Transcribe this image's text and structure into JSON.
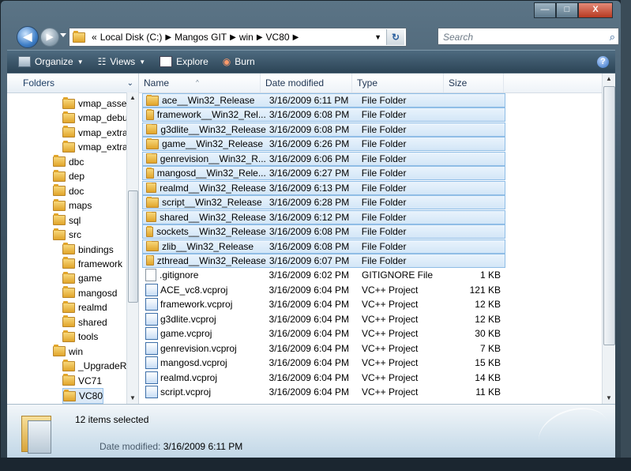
{
  "window": {
    "minimize": "—",
    "maximize": "□",
    "close": "X"
  },
  "address": {
    "chevron": "«",
    "crumbs": [
      "Local Disk (C:)",
      "Mangos GIT",
      "win",
      "VC80"
    ],
    "search_placeholder": "Search"
  },
  "toolbar": {
    "organize": "Organize",
    "views": "Views",
    "explore": "Explore",
    "burn": "Burn"
  },
  "nav": {
    "header": "Folders",
    "items": [
      {
        "label": "vmap_asse",
        "level": 2
      },
      {
        "label": "vmap_debu",
        "level": 2
      },
      {
        "label": "vmap_extra",
        "level": 2
      },
      {
        "label": "vmap_extra",
        "level": 2
      },
      {
        "label": "dbc",
        "level": 1
      },
      {
        "label": "dep",
        "level": 1
      },
      {
        "label": "doc",
        "level": 1
      },
      {
        "label": "maps",
        "level": 1
      },
      {
        "label": "sql",
        "level": 1
      },
      {
        "label": "src",
        "level": 1
      },
      {
        "label": "bindings",
        "level": 2
      },
      {
        "label": "framework",
        "level": 2
      },
      {
        "label": "game",
        "level": 2
      },
      {
        "label": "mangosd",
        "level": 2
      },
      {
        "label": "realmd",
        "level": 2
      },
      {
        "label": "shared",
        "level": 2
      },
      {
        "label": "tools",
        "level": 2
      },
      {
        "label": "win",
        "level": 1
      },
      {
        "label": "_UpgradeR",
        "level": 2
      },
      {
        "label": "VC71",
        "level": 2
      },
      {
        "label": "VC80",
        "level": 2,
        "selected": true
      }
    ]
  },
  "columns": {
    "name": "Name",
    "date": "Date modified",
    "type": "Type",
    "size": "Size"
  },
  "files": [
    {
      "name": "ace__Win32_Release",
      "date": "3/16/2009 6:11 PM",
      "type": "File Folder",
      "size": "",
      "kind": "folder",
      "selected": true
    },
    {
      "name": "framework__Win32_Rel...",
      "date": "3/16/2009 6:08 PM",
      "type": "File Folder",
      "size": "",
      "kind": "folder",
      "selected": true
    },
    {
      "name": "g3dlite__Win32_Release",
      "date": "3/16/2009 6:08 PM",
      "type": "File Folder",
      "size": "",
      "kind": "folder",
      "selected": true
    },
    {
      "name": "game__Win32_Release",
      "date": "3/16/2009 6:26 PM",
      "type": "File Folder",
      "size": "",
      "kind": "folder",
      "selected": true
    },
    {
      "name": "genrevision__Win32_R...",
      "date": "3/16/2009 6:06 PM",
      "type": "File Folder",
      "size": "",
      "kind": "folder",
      "selected": true
    },
    {
      "name": "mangosd__Win32_Rele...",
      "date": "3/16/2009 6:27 PM",
      "type": "File Folder",
      "size": "",
      "kind": "folder",
      "selected": true
    },
    {
      "name": "realmd__Win32_Release",
      "date": "3/16/2009 6:13 PM",
      "type": "File Folder",
      "size": "",
      "kind": "folder",
      "selected": true
    },
    {
      "name": "script__Win32_Release",
      "date": "3/16/2009 6:28 PM",
      "type": "File Folder",
      "size": "",
      "kind": "folder",
      "selected": true
    },
    {
      "name": "shared__Win32_Release",
      "date": "3/16/2009 6:12 PM",
      "type": "File Folder",
      "size": "",
      "kind": "folder",
      "selected": true
    },
    {
      "name": "sockets__Win32_Release",
      "date": "3/16/2009 6:08 PM",
      "type": "File Folder",
      "size": "",
      "kind": "folder",
      "selected": true
    },
    {
      "name": "zlib__Win32_Release",
      "date": "3/16/2009 6:08 PM",
      "type": "File Folder",
      "size": "",
      "kind": "folder",
      "selected": true
    },
    {
      "name": "zthread__Win32_Release",
      "date": "3/16/2009 6:07 PM",
      "type": "File Folder",
      "size": "",
      "kind": "folder",
      "selected": true
    },
    {
      "name": ".gitignore",
      "date": "3/16/2009 6:02 PM",
      "type": "GITIGNORE File",
      "size": "1 KB",
      "kind": "file"
    },
    {
      "name": "ACE_vc8.vcproj",
      "date": "3/16/2009 6:04 PM",
      "type": "VC++ Project",
      "size": "121 KB",
      "kind": "project"
    },
    {
      "name": "framework.vcproj",
      "date": "3/16/2009 6:04 PM",
      "type": "VC++ Project",
      "size": "12 KB",
      "kind": "project"
    },
    {
      "name": "g3dlite.vcproj",
      "date": "3/16/2009 6:04 PM",
      "type": "VC++ Project",
      "size": "12 KB",
      "kind": "project"
    },
    {
      "name": "game.vcproj",
      "date": "3/16/2009 6:04 PM",
      "type": "VC++ Project",
      "size": "30 KB",
      "kind": "project"
    },
    {
      "name": "genrevision.vcproj",
      "date": "3/16/2009 6:04 PM",
      "type": "VC++ Project",
      "size": "7 KB",
      "kind": "project"
    },
    {
      "name": "mangosd.vcproj",
      "date": "3/16/2009 6:04 PM",
      "type": "VC++ Project",
      "size": "15 KB",
      "kind": "project"
    },
    {
      "name": "realmd.vcproj",
      "date": "3/16/2009 6:04 PM",
      "type": "VC++ Project",
      "size": "14 KB",
      "kind": "project"
    },
    {
      "name": "script.vcproj",
      "date": "3/16/2009 6:04 PM",
      "type": "VC++ Project",
      "size": "11 KB",
      "kind": "project"
    }
  ],
  "details": {
    "summary": "12 items selected",
    "date_label": "Date modified:",
    "date_value": "3/16/2009 6:11 PM"
  },
  "colors": {
    "selection_fill": "#d3e6f7",
    "selection_border": "#8fbde6",
    "folder": "#e1a52a"
  }
}
